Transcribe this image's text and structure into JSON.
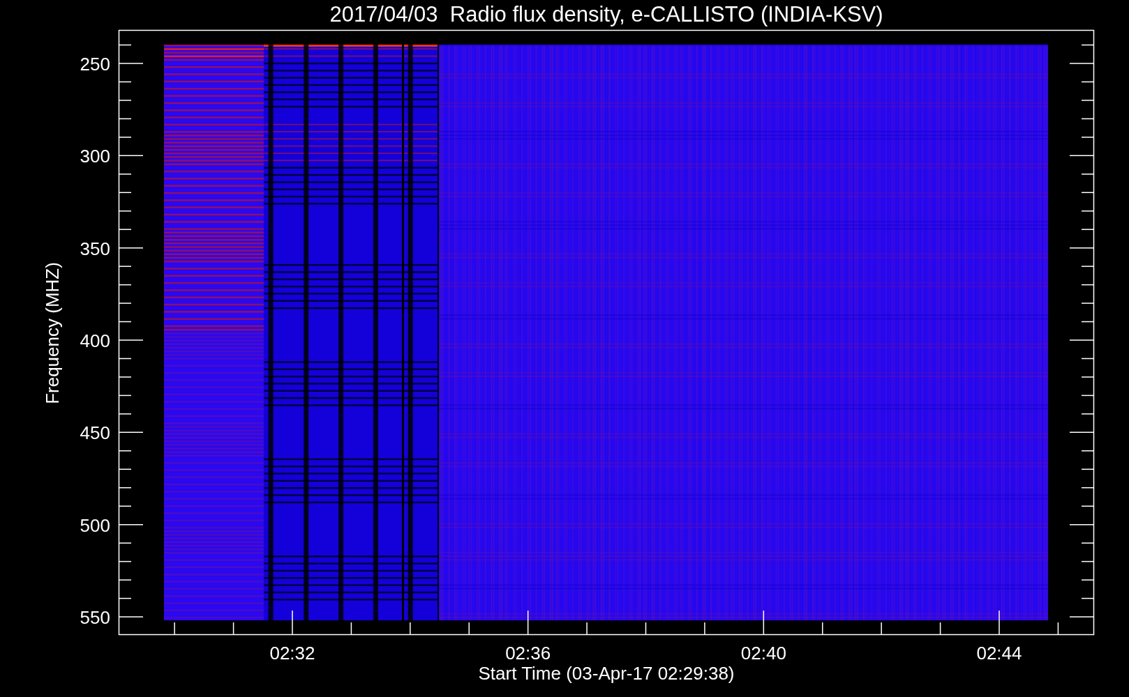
{
  "title": "2017/04/03  Radio flux density, e-CALLISTO (INDIA-KSV)",
  "plot": {
    "ylabel": "Frequency (MHZ)",
    "xlabel": "Start Time (03-Apr-17 02:29:38)",
    "yticks": [
      "250",
      "300",
      "350",
      "400",
      "450",
      "500",
      "550"
    ],
    "xticks": [
      "02:32",
      "02:36",
      "02:40",
      "02:44"
    ]
  }
}
